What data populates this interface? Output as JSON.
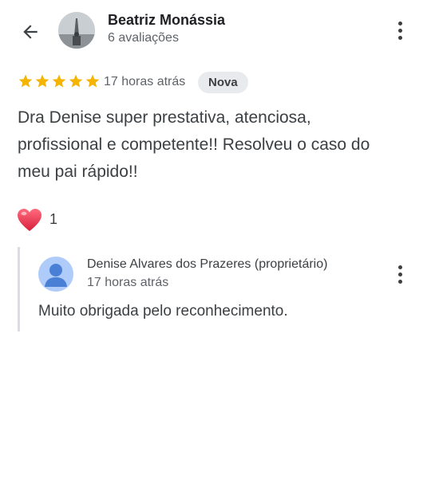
{
  "header": {
    "reviewer_name": "Beatriz Monássia",
    "reviewer_review_count": "6 avaliações"
  },
  "review": {
    "rating": 5,
    "max_rating": 5,
    "time_ago": "17 horas atrás",
    "badge": "Nova",
    "text_lines": [
      "Dra Denise super prestativa, atenciosa,",
      "profissional e competente!! Resolveu o caso do",
      "meu pai rápido!!"
    ],
    "reaction_count": "1"
  },
  "owner_reply": {
    "name": "Denise Alvares dos Prazeres (proprietário)",
    "time_ago": "17 horas atrás",
    "text": "Muito obrigada pelo reconhecimento."
  },
  "colors": {
    "star": "#f4b400",
    "heart": "#e8304a",
    "badge_bg": "#e8eaed",
    "owner_avatar_bg": "#aecbfa",
    "owner_avatar_fg": "#4a7fd6"
  },
  "icons": {
    "back": "arrow-back-icon",
    "menu": "more-vert-icon",
    "star": "star-icon",
    "heart": "heart-icon",
    "owner_avatar": "person-icon"
  }
}
